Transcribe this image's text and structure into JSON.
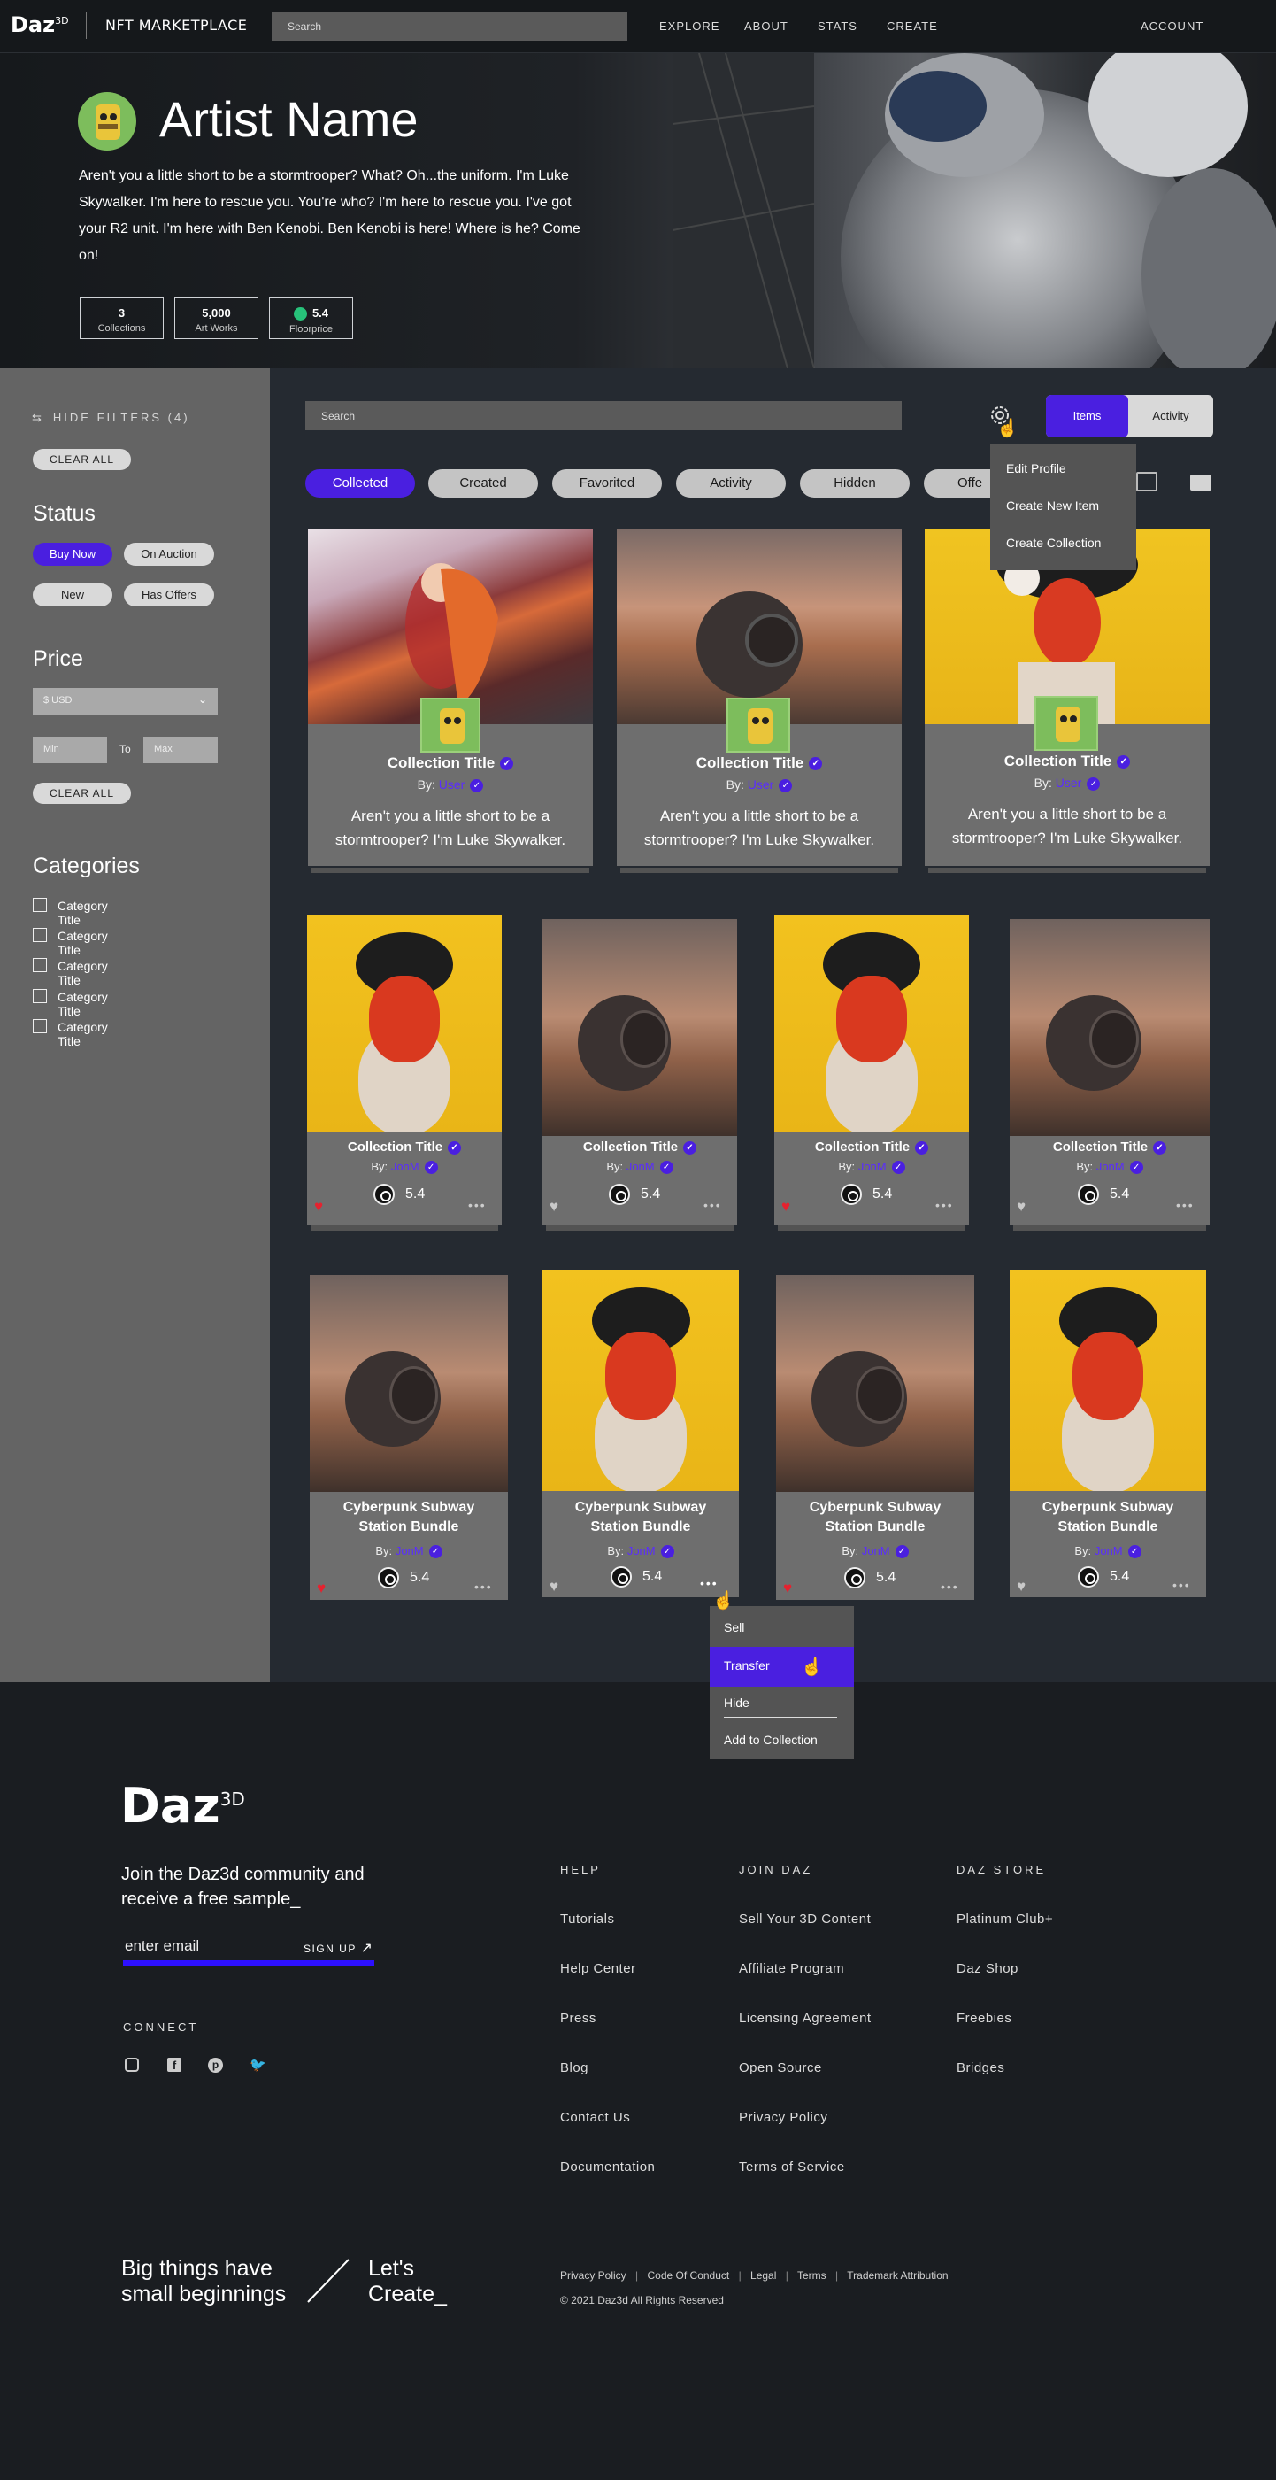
{
  "nav": {
    "logo": "Daz",
    "logo_sup": "3D",
    "brand": "NFT MARKETPLACE",
    "search_placeholder": "Search",
    "links": [
      "EXPLORE",
      "ABOUT",
      "STATS",
      "CREATE"
    ],
    "account": "ACCOUNT"
  },
  "hero": {
    "artist_name": "Artist Name",
    "bio": "Aren't you a little short to be a stormtrooper? What? Oh...the uniform. I'm Luke Skywalker. I'm here to rescue you. You're who? I'm here to rescue you. I've got your R2 unit. I'm here with Ben Kenobi. Ben Kenobi is here! Where is he? Come on!",
    "stats": [
      {
        "value": "3",
        "label": "Collections"
      },
      {
        "value": "5,000",
        "label": "Art Works"
      },
      {
        "value": "5.4",
        "label": "Floorprice"
      }
    ]
  },
  "sidebar": {
    "hide_filters": "HIDE FILTERS (4)",
    "clear_all": "CLEAR ALL",
    "status_title": "Status",
    "status_options": [
      "Buy Now",
      "On Auction",
      "New",
      "Has Offers"
    ],
    "status_active": "Buy Now",
    "price_title": "Price",
    "currency": "$ USD",
    "min_placeholder": "Min",
    "to": "To",
    "max_placeholder": "Max",
    "clear_all_2": "CLEAR ALL",
    "categories_title": "Categories",
    "categories": [
      "Category Title",
      "Category Title",
      "Category Title",
      "Category Title",
      "Category Title"
    ]
  },
  "main": {
    "search_placeholder": "Search",
    "view_toggle": [
      "Items",
      "Activity"
    ],
    "view_active": "Items",
    "settings_menu": [
      "Edit Profile",
      "Create New Item",
      "Create Collection"
    ],
    "tabs": [
      "Collected",
      "Created",
      "Favorited",
      "Activity",
      "Hidden",
      "Offe"
    ],
    "tab_active": "Collected",
    "collections": [
      {
        "title": "Collection Title",
        "by": "By:",
        "user": "User",
        "desc": "Aren't you a little short to be a stormtrooper? I'm Luke Skywalker."
      },
      {
        "title": "Collection Title",
        "by": "By:",
        "user": "User",
        "desc": "Aren't you a little short to be a stormtrooper? I'm Luke Skywalker."
      },
      {
        "title": "Collection Title",
        "by": "By:",
        "user": "User",
        "desc": "Aren't you a little short to be a stormtrooper? I'm Luke Skywalker."
      }
    ],
    "items_row1": [
      {
        "title": "Collection Title",
        "by": "By:",
        "user": "JonM",
        "price": "5.4",
        "liked": true
      },
      {
        "title": "Collection Title",
        "by": "By:",
        "user": "JonM",
        "price": "5.4",
        "liked": false
      },
      {
        "title": "Collection Title",
        "by": "By:",
        "user": "JonM",
        "price": "5.4",
        "liked": true
      },
      {
        "title": "Collection Title",
        "by": "By:",
        "user": "JonM",
        "price": "5.4",
        "liked": false
      }
    ],
    "items_row2": [
      {
        "title": "Cyberpunk Subway Station Bundle",
        "by": "By:",
        "user": "JonM",
        "price": "5.4",
        "liked": true
      },
      {
        "title": "Cyberpunk Subway Station Bundle",
        "by": "By:",
        "user": "JonM",
        "price": "5.4",
        "liked": false
      },
      {
        "title": "Cyberpunk Subway Station Bundle",
        "by": "By:",
        "user": "JonM",
        "price": "5.4",
        "liked": true
      },
      {
        "title": "Cyberpunk Subway Station Bundle",
        "by": "By:",
        "user": "JonM",
        "price": "5.4",
        "liked": false
      }
    ],
    "item_menu": [
      "Sell",
      "Transfer",
      "Hide",
      "Add to Collection"
    ],
    "item_menu_active": "Transfer"
  },
  "footer": {
    "logo": "Daz",
    "logo_sup": "3D",
    "join_text": "Join the Daz3d community and receive a free sample_",
    "email_placeholder": "enter email",
    "signup": "SIGN UP",
    "connect": "CONNECT",
    "social_icons": [
      "instagram-icon",
      "facebook-icon",
      "pinterest-icon",
      "twitter-icon"
    ],
    "columns": [
      {
        "head": "HELP",
        "links": [
          "Tutorials",
          "Help Center",
          "Press",
          "Blog",
          "Contact Us",
          "Documentation"
        ]
      },
      {
        "head": "JOIN DAZ",
        "links": [
          "Sell Your 3D Content",
          "Affiliate Program",
          "Licensing Agreement",
          "Open Source",
          "Privacy Policy",
          "Terms of Service"
        ]
      },
      {
        "head": "DAZ STORE",
        "links": [
          "Platinum Club+",
          "Daz Shop",
          "Freebies",
          "Bridges"
        ]
      }
    ],
    "tagline_left": "Big things have small beginnings",
    "tagline_right": "Let's Create_",
    "legal_links": [
      "Privacy Policy",
      "Code Of Conduct",
      "Legal",
      "Terms",
      "Trademark Attribution"
    ],
    "copyright": "© 2021 Daz3d All Rights Reserved"
  },
  "colors": {
    "accent": "#4a1fe0",
    "sidebar": "#646464",
    "main_bg": "#252a31",
    "footer_bg": "#1a1d21",
    "like_red": "#e5222f"
  }
}
